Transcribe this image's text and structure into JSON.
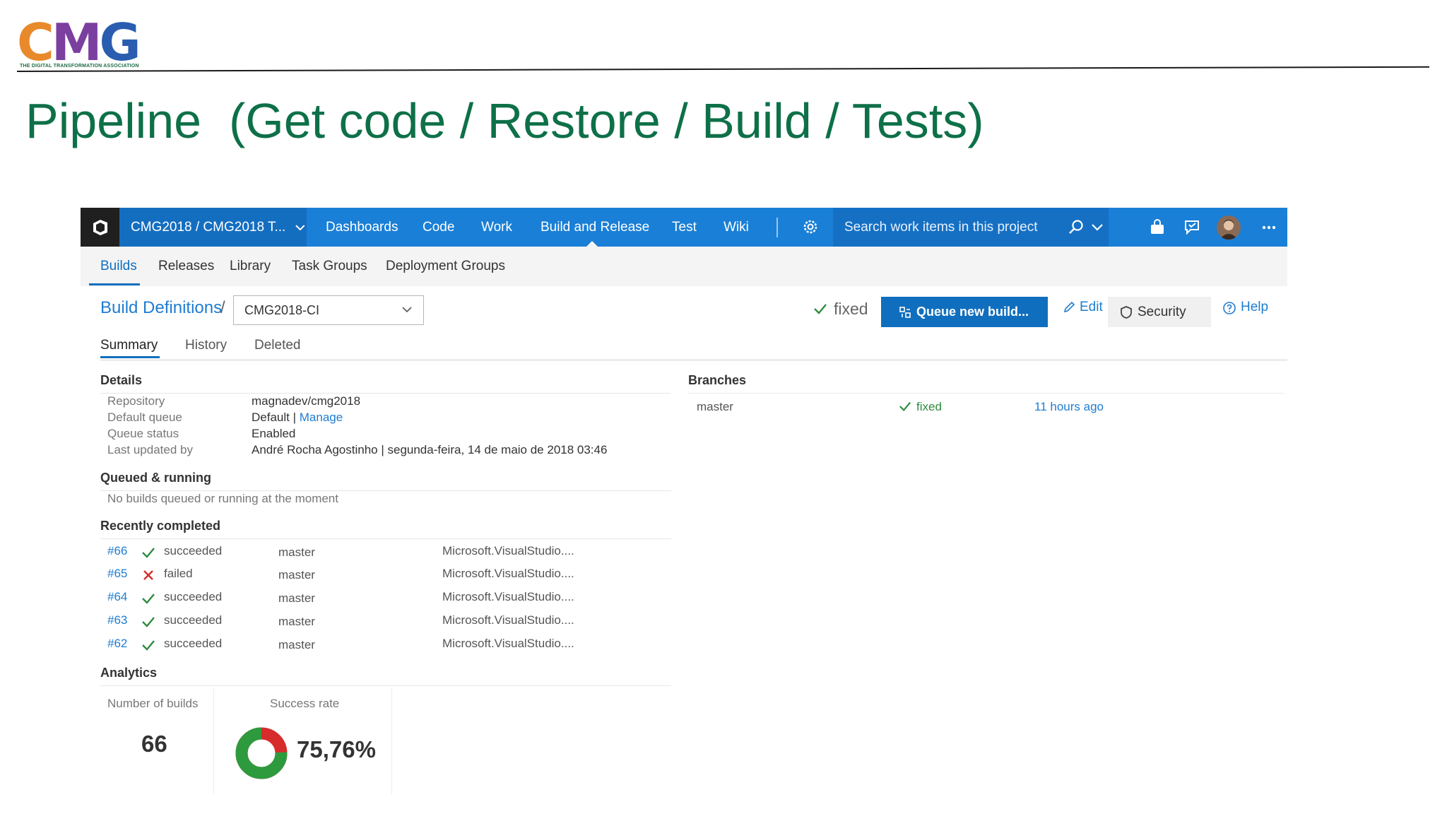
{
  "slide": {
    "logo_text": "CMG",
    "logo_tagline": "THE DIGITAL TRANSFORMATION ASSOCIATION",
    "title": "Pipeline  (Get code / Restore / Build / Tests)",
    "colors": {
      "title": "#0e7048",
      "logo_orange": "#e8892b",
      "logo_green": "#3aa35b",
      "logo_blue": "#2a5db0",
      "logo_purple": "#7b3fa0"
    }
  },
  "topnav": {
    "project": "CMG2018 / CMG2018 T...",
    "items": [
      "Dashboards",
      "Code",
      "Work",
      "Build and Release",
      "Test",
      "Wiki"
    ],
    "active": "Build and Release",
    "search_placeholder": "Search work items in this project",
    "colors": {
      "bar": "#1a7fd6",
      "logo_bg": "#1f1f1f"
    }
  },
  "subnav": {
    "items": [
      "Builds",
      "Releases",
      "Library",
      "Task Groups",
      "Deployment Groups"
    ],
    "active": "Builds"
  },
  "header": {
    "breadcrumb": "Build Definitions",
    "separator": "/",
    "definition": "CMG2018-CI",
    "status": "fixed",
    "queue_button": "Queue new build...",
    "edit": "Edit",
    "security": "Security",
    "help": "Help"
  },
  "tabs": [
    "Summary",
    "History",
    "Deleted"
  ],
  "details": {
    "title": "Details",
    "rows": [
      {
        "key": "Repository",
        "value": "magnadev/cmg2018"
      },
      {
        "key": "Default queue",
        "value": "Default",
        "link": "Manage",
        "sep": " | "
      },
      {
        "key": "Queue status",
        "value": "Enabled"
      },
      {
        "key": "Last updated by",
        "value": "André Rocha Agostinho",
        "extra": " | segunda-feira, 14 de maio de 2018 03:46"
      }
    ]
  },
  "queued": {
    "title": "Queued & running",
    "message": "No builds queued or running at the moment"
  },
  "recent": {
    "title": "Recently completed",
    "builds": [
      {
        "id": "#66",
        "status": "succeeded",
        "branch": "master",
        "definition": "Microsoft.VisualStudio...."
      },
      {
        "id": "#65",
        "status": "failed",
        "branch": "master",
        "definition": "Microsoft.VisualStudio...."
      },
      {
        "id": "#64",
        "status": "succeeded",
        "branch": "master",
        "definition": "Microsoft.VisualStudio...."
      },
      {
        "id": "#63",
        "status": "succeeded",
        "branch": "master",
        "definition": "Microsoft.VisualStudio...."
      },
      {
        "id": "#62",
        "status": "succeeded",
        "branch": "master",
        "definition": "Microsoft.VisualStudio...."
      }
    ]
  },
  "analytics": {
    "title": "Analytics",
    "builds_label": "Number of builds",
    "builds_value": "66",
    "rate_label": "Success rate",
    "rate_value": "75,76%",
    "rate_fraction": 0.7576,
    "colors": {
      "success": "#2e9a3e",
      "fail": "#d62c2c"
    }
  },
  "branches": {
    "title": "Branches",
    "rows": [
      {
        "name": "master",
        "status": "fixed",
        "time": "11 hours ago"
      }
    ]
  }
}
